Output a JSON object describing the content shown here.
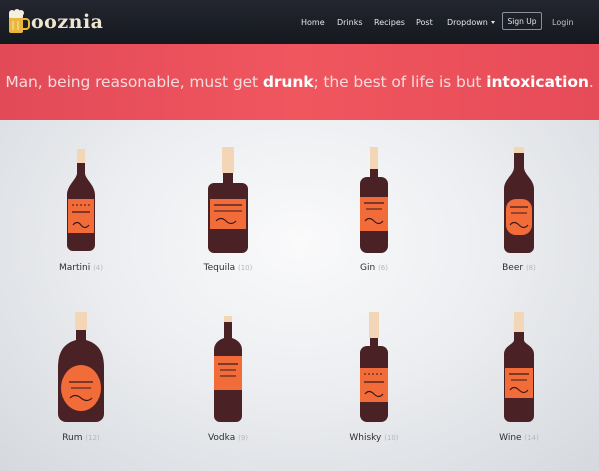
{
  "app": {
    "logo_text": "ooznia"
  },
  "nav": {
    "items": [
      "Home",
      "Drinks",
      "Recipes",
      "Post",
      "Dropdown"
    ],
    "signup": "Sign Up",
    "login": "Login"
  },
  "hero": {
    "prefix": "Man, being reasonable, must get ",
    "emph1": "drunk",
    "middle": "; the best of life is but ",
    "emph2": "intoxication",
    "suffix": "."
  },
  "drinks": [
    {
      "name": "Martini",
      "count": "(4)",
      "label": "MARTINI"
    },
    {
      "name": "Tequila",
      "count": "(10)",
      "label": "TEQUILA"
    },
    {
      "name": "Gin",
      "count": "(6)",
      "label": "GIN"
    },
    {
      "name": "Beer",
      "count": "(8)",
      "label": "BEER"
    },
    {
      "name": "Rum",
      "count": "(12)",
      "label": "RUM"
    },
    {
      "name": "Vodka",
      "count": "(9)",
      "label": "VODKA"
    },
    {
      "name": "Whisky",
      "count": "(10)",
      "label": "WHISKEY"
    },
    {
      "name": "Wine",
      "count": "(14)",
      "label": "WINE"
    }
  ],
  "colors": {
    "bottle": "#4a2124",
    "label": "#f26c3a",
    "cork": "#f3d6b6",
    "hero": "#f0565e"
  }
}
